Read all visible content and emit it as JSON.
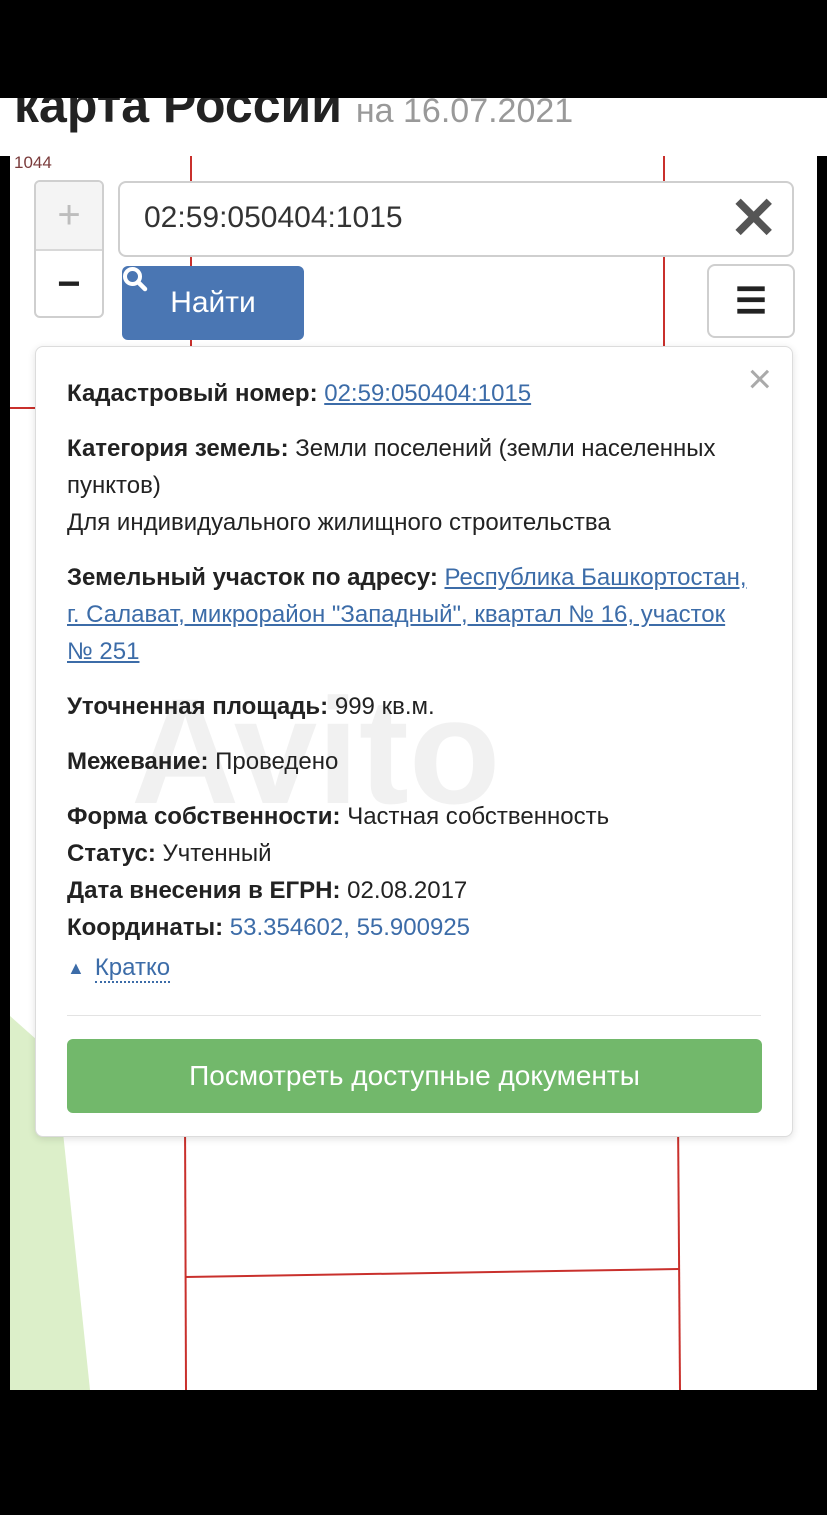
{
  "header": {
    "title": "карта России",
    "date": "на 16.07.2021"
  },
  "map": {
    "parcel_label": "1044",
    "colors": {
      "boundary": "#c9302c",
      "green_area": "#dcefc9"
    }
  },
  "zoom": {
    "in_label": "+",
    "out_label": "−"
  },
  "search": {
    "value": "02:59:050404:1015",
    "clear_icon": "close-icon",
    "find_label": "Найти",
    "menu_icon": "hamburger-icon"
  },
  "popup": {
    "close_label": "×",
    "watermark": "Avito",
    "cadastral": {
      "label": "Кадастровый номер:",
      "value": "02:59:050404:1015"
    },
    "category": {
      "label": "Категория земель:",
      "value": "Земли поселений (земли населенных пунктов)",
      "use": "Для индивидуального жилищного строительства"
    },
    "address": {
      "label": "Земельный участок по адресу:",
      "value": "Республика Башкортостан, г. Салават, микрорайон \"Западный\", квартал № 16, участок № 251"
    },
    "area": {
      "label": "Уточненная площадь:",
      "value": "999 кв.м."
    },
    "survey": {
      "label": "Межевание:",
      "value": "Проведено"
    },
    "ownership": {
      "label": "Форма собственности:",
      "value": "Частная собственность"
    },
    "status": {
      "label": "Статус:",
      "value": "Учтенный"
    },
    "egrn_date": {
      "label": "Дата внесения в ЕГРН:",
      "value": "02.08.2017"
    },
    "coords": {
      "label": "Координаты:",
      "value": "53.354602, 55.900925"
    },
    "brief_toggle": "Кратко",
    "docs_button": "Посмотреть доступные документы"
  },
  "colors": {
    "primary": "#4a76b3",
    "success": "#72b86b",
    "link": "#3c6ca8"
  }
}
